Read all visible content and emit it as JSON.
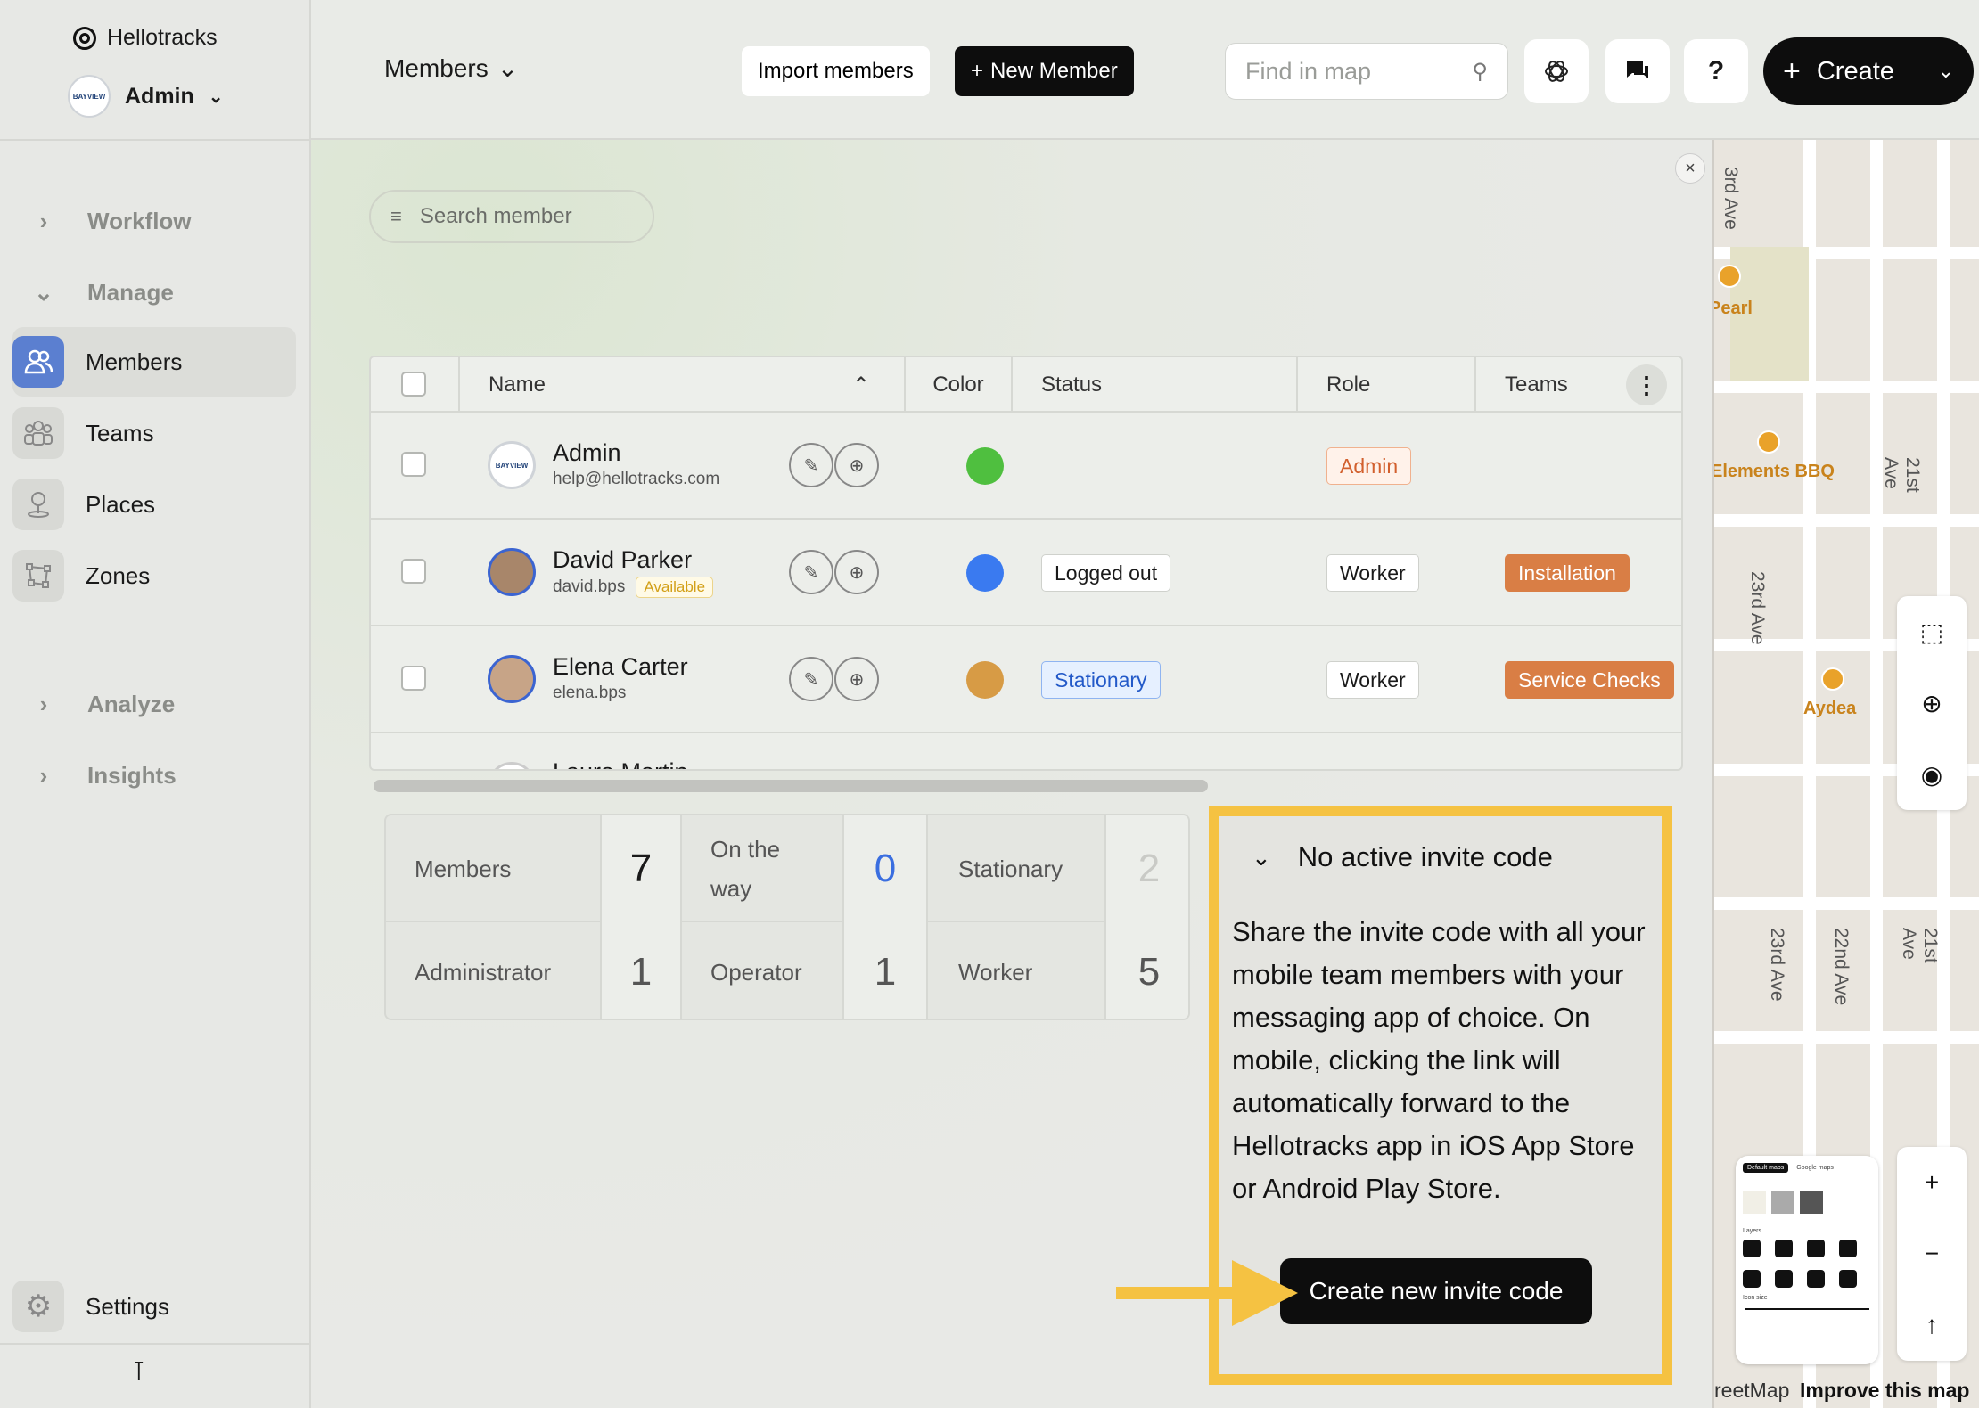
{
  "brand": "Hellotracks",
  "account": {
    "name": "Admin",
    "logo_text": "BAYVIEW"
  },
  "sidebar": {
    "sections": [
      {
        "label": "Workflow",
        "expanded": false
      },
      {
        "label": "Manage",
        "expanded": true
      },
      {
        "label": "Analyze",
        "expanded": false
      },
      {
        "label": "Insights",
        "expanded": false
      }
    ],
    "items": [
      {
        "label": "Members",
        "icon": "members-icon",
        "active": true
      },
      {
        "label": "Teams",
        "icon": "teams-icon",
        "active": false
      },
      {
        "label": "Places",
        "icon": "places-icon",
        "active": false
      },
      {
        "label": "Zones",
        "icon": "zones-icon",
        "active": false
      }
    ],
    "settings": "Settings"
  },
  "topbar": {
    "view_label": "Members",
    "import_label": "Import members",
    "new_label": "New Member",
    "search_placeholder": "Find in map",
    "create_label": "Create"
  },
  "members": {
    "search_placeholder": "Search member",
    "columns": [
      "Name",
      "Color",
      "Status",
      "Role",
      "Teams"
    ],
    "rows": [
      {
        "name": "Admin",
        "email": "help@hellotracks.com",
        "badge": "",
        "color": "#4fbf3f",
        "status": "",
        "role": "Admin",
        "team": ""
      },
      {
        "name": "David Parker",
        "email": "david.bps",
        "badge": "Available",
        "color": "#3a7af0",
        "status": "Logged out",
        "role": "Worker",
        "team": "Installation"
      },
      {
        "name": "Elena Carter",
        "email": "elena.bps",
        "badge": "",
        "color": "#d79b45",
        "status": "Stationary",
        "role": "Worker",
        "team": "Service Checks"
      }
    ],
    "partial_row_name": "Laura Martin"
  },
  "stats": {
    "members_label": "Members",
    "members": "7",
    "onway_label": "On the way",
    "onway": "0",
    "stationary_label": "Stationary",
    "stationary": "2",
    "admin_label": "Administrator",
    "admin": "1",
    "operator_label": "Operator",
    "operator": "1",
    "worker_label": "Worker",
    "worker": "5"
  },
  "invite": {
    "title": "No active invite code",
    "text": "Share the invite code with all your mobile team members with your messaging app of choice. On mobile, clicking the link will automatically forward to the Hellotracks app in iOS App Store or Android Play Store.",
    "button": "Create new invite code"
  },
  "map": {
    "labels": [
      "3rd Ave",
      "21st Ave",
      "23rd Ave",
      "22nd Ave",
      "21st Ave",
      "23rd Ave"
    ],
    "pois": [
      "Pearl",
      "Elements BBQ",
      "Aydea"
    ],
    "attribution": "reetMap",
    "improve": "Improve this map",
    "minimap": {
      "default_tab": "Default maps",
      "google_tab": "Google maps",
      "layers": "Layers",
      "icon_size": "Icon size"
    }
  },
  "colors": {
    "accent": "#0d0d0d",
    "highlight": "#f5c242",
    "team": "#d97e45"
  }
}
